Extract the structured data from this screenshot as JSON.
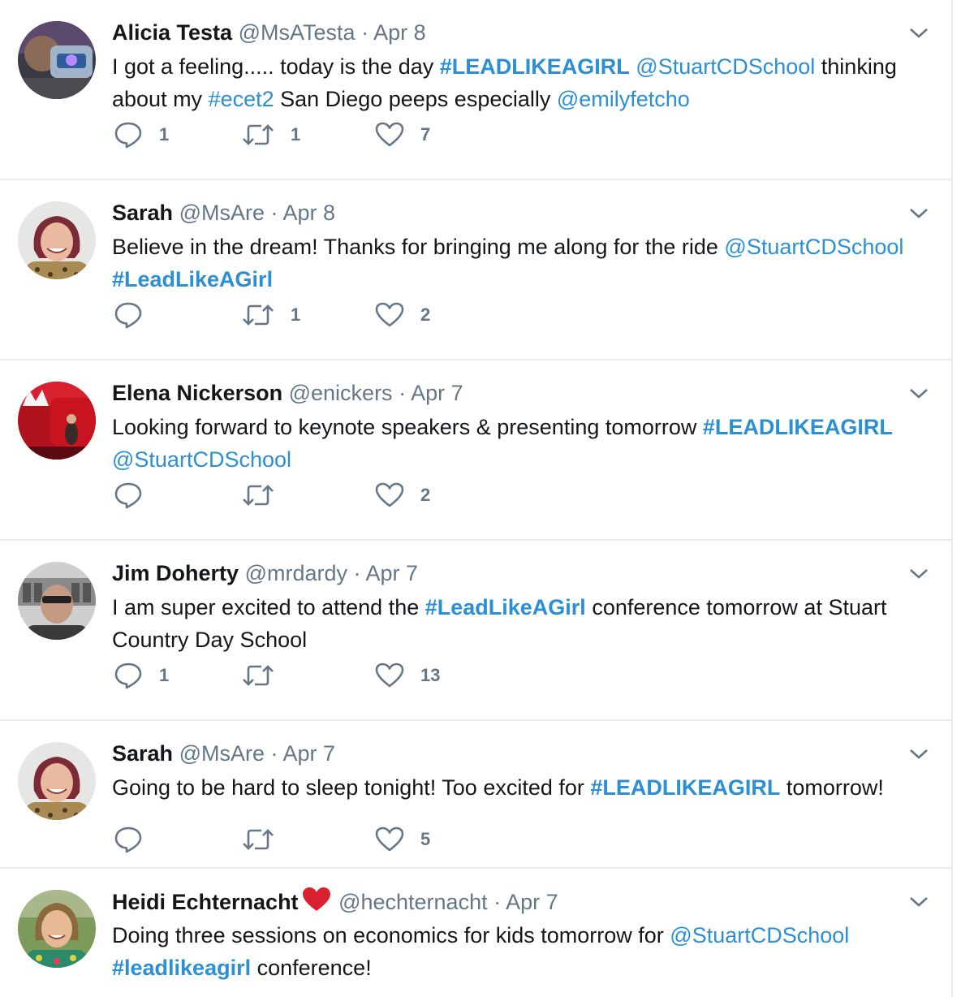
{
  "colors": {
    "link": "#2b8fd6",
    "name": "#14171a",
    "muted": "#657786",
    "divider": "#e6ecf0",
    "heart": "#e0245e"
  },
  "tweets": [
    {
      "name": "Alicia Testa",
      "handle": "@MsATesta",
      "sep": "·",
      "date": "Apr 8",
      "avatar": "photo-avatar",
      "parts": [
        {
          "text": "I got a feeling..... today is the day ",
          "type": "text"
        },
        {
          "text": "#LEADLIKEAGIRL",
          "type": "hashtag"
        },
        {
          "text": " ",
          "type": "text"
        },
        {
          "text": "@StuartCDSchool",
          "type": "mention"
        },
        {
          "text": " thinking about my ",
          "type": "text"
        },
        {
          "text": "#ecet2",
          "type": "hashtag-light"
        },
        {
          "text": " San Diego peeps especially ",
          "type": "text"
        },
        {
          "text": "@emilyfetcho",
          "type": "mention"
        }
      ],
      "replies": "1",
      "retweets": "1",
      "likes": "7"
    },
    {
      "name": "Sarah",
      "handle": "@MsAre",
      "sep": "·",
      "date": "Apr 8",
      "avatar": "photo-avatar",
      "parts": [
        {
          "text": "Believe in the dream! Thanks for bringing me along for the ride ",
          "type": "text"
        },
        {
          "text": "@StuartCDSchool",
          "type": "mention"
        },
        {
          "text": " ",
          "type": "text"
        },
        {
          "text": "#LeadLikeAGirl",
          "type": "hashtag"
        }
      ],
      "replies": "",
      "retweets": "1",
      "likes": "2"
    },
    {
      "name": "Elena Nickerson",
      "handle": "@enickers",
      "sep": "·",
      "date": "Apr 7",
      "avatar": "photo-avatar",
      "parts": [
        {
          "text": "Looking forward to keynote speakers & presenting tomorrow ",
          "type": "text"
        },
        {
          "text": "#LEADLIKEAGIRL",
          "type": "hashtag"
        },
        {
          "text": " ",
          "type": "text"
        },
        {
          "text": "@StuartCDSchool",
          "type": "mention"
        }
      ],
      "replies": "",
      "retweets": "",
      "likes": "2"
    },
    {
      "name": "Jim Doherty",
      "handle": "@mrdardy",
      "sep": "·",
      "date": "Apr 7",
      "avatar": "photo-avatar",
      "parts": [
        {
          "text": "I am super excited to attend the ",
          "type": "text"
        },
        {
          "text": "#LeadLikeAGirl",
          "type": "hashtag"
        },
        {
          "text": " conference tomorrow at Stuart Country Day School",
          "type": "text"
        }
      ],
      "replies": "1",
      "retweets": "",
      "likes": "13"
    },
    {
      "name": "Sarah",
      "handle": "@MsAre",
      "sep": "·",
      "date": "Apr 7",
      "avatar": "photo-avatar",
      "parts": [
        {
          "text": "Going to be hard to sleep tonight! Too excited for ",
          "type": "text"
        },
        {
          "text": "#LEADLIKEAGIRL",
          "type": "hashtag"
        },
        {
          "text": " tomorrow!",
          "type": "text"
        }
      ],
      "replies": "",
      "retweets": "",
      "likes": "5"
    },
    {
      "name": "Heidi Echternacht",
      "handle": "@hechternacht",
      "sep": "·",
      "date": "Apr 7",
      "avatar": "photo-avatar",
      "name_emoji": "red-heart-emoji",
      "parts": [
        {
          "text": "Doing three sessions on economics for kids tomorrow for ",
          "type": "text"
        },
        {
          "text": "@StuartCDSchool",
          "type": "mention"
        },
        {
          "text": " ",
          "type": "text"
        },
        {
          "text": "#leadlikeagirl",
          "type": "hashtag"
        },
        {
          "text": " conference!",
          "type": "text"
        }
      ],
      "replies": "",
      "retweets": "",
      "likes": ""
    }
  ]
}
